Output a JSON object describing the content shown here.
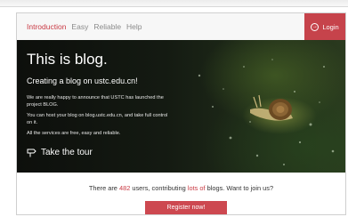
{
  "nav": {
    "items": [
      "Introduction",
      "Easy",
      "Reliable",
      "Help"
    ],
    "login_label": "Login"
  },
  "hero": {
    "title": "This is blog.",
    "subtitle": "Creating a blog on ustc.edu.cn!",
    "paragraphs": [
      "We are really happy to announce that USTC has launched the project BLOG.",
      "You can host your blog on blog.ustc.edu.cn, and take full control on it.",
      "All the services are free, easy and reliable."
    ],
    "tour_label": "Take the tour"
  },
  "stats": {
    "prefix": "There are ",
    "users": "482",
    "middle": " users, contributing ",
    "blogs": "lots of",
    "suffix": " blogs. Want to join us?"
  },
  "register_label": "Register now!",
  "colors": {
    "accent": "#c93a44",
    "button": "#cd4850"
  },
  "icons": {
    "login": "login-arrow-icon",
    "tour": "signpost-icon"
  }
}
